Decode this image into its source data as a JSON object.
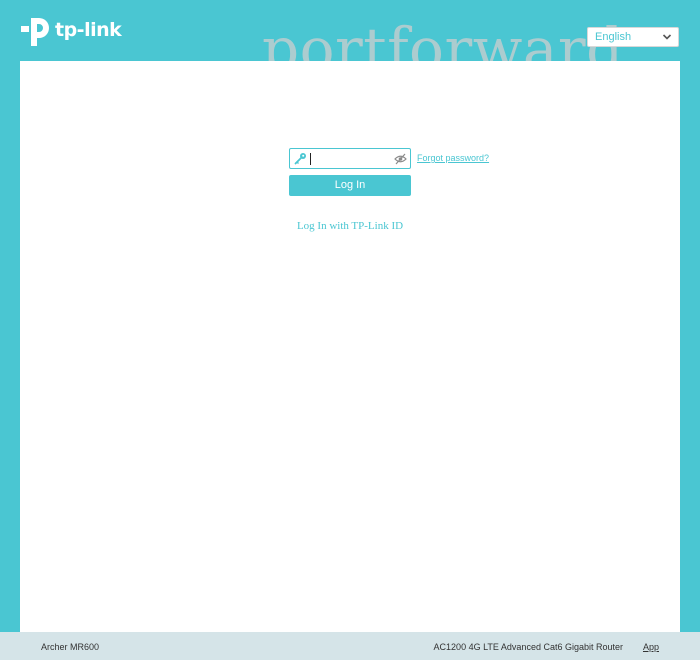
{
  "header": {
    "brand_name": "tp-link",
    "watermark": "portforward",
    "language": {
      "selected": "English"
    }
  },
  "login": {
    "password_value": "",
    "forgot_label": "Forgot password?",
    "login_label": "Log In",
    "tplink_id_label": "Log In with TP-Link ID"
  },
  "footer": {
    "model": "Archer MR600",
    "description": "AC1200 4G LTE Advanced Cat6 Gigabit Router",
    "app_label": "App"
  },
  "icons": {
    "logo": "tp-link-logo-icon",
    "language_arrow": "chevron-down-icon",
    "password_field": "key-icon",
    "password_visibility": "eye-off-icon"
  },
  "colors": {
    "accent": "#4ac6d2",
    "footer_bg": "#d5e4e8",
    "content_bg": "#ffffff"
  }
}
